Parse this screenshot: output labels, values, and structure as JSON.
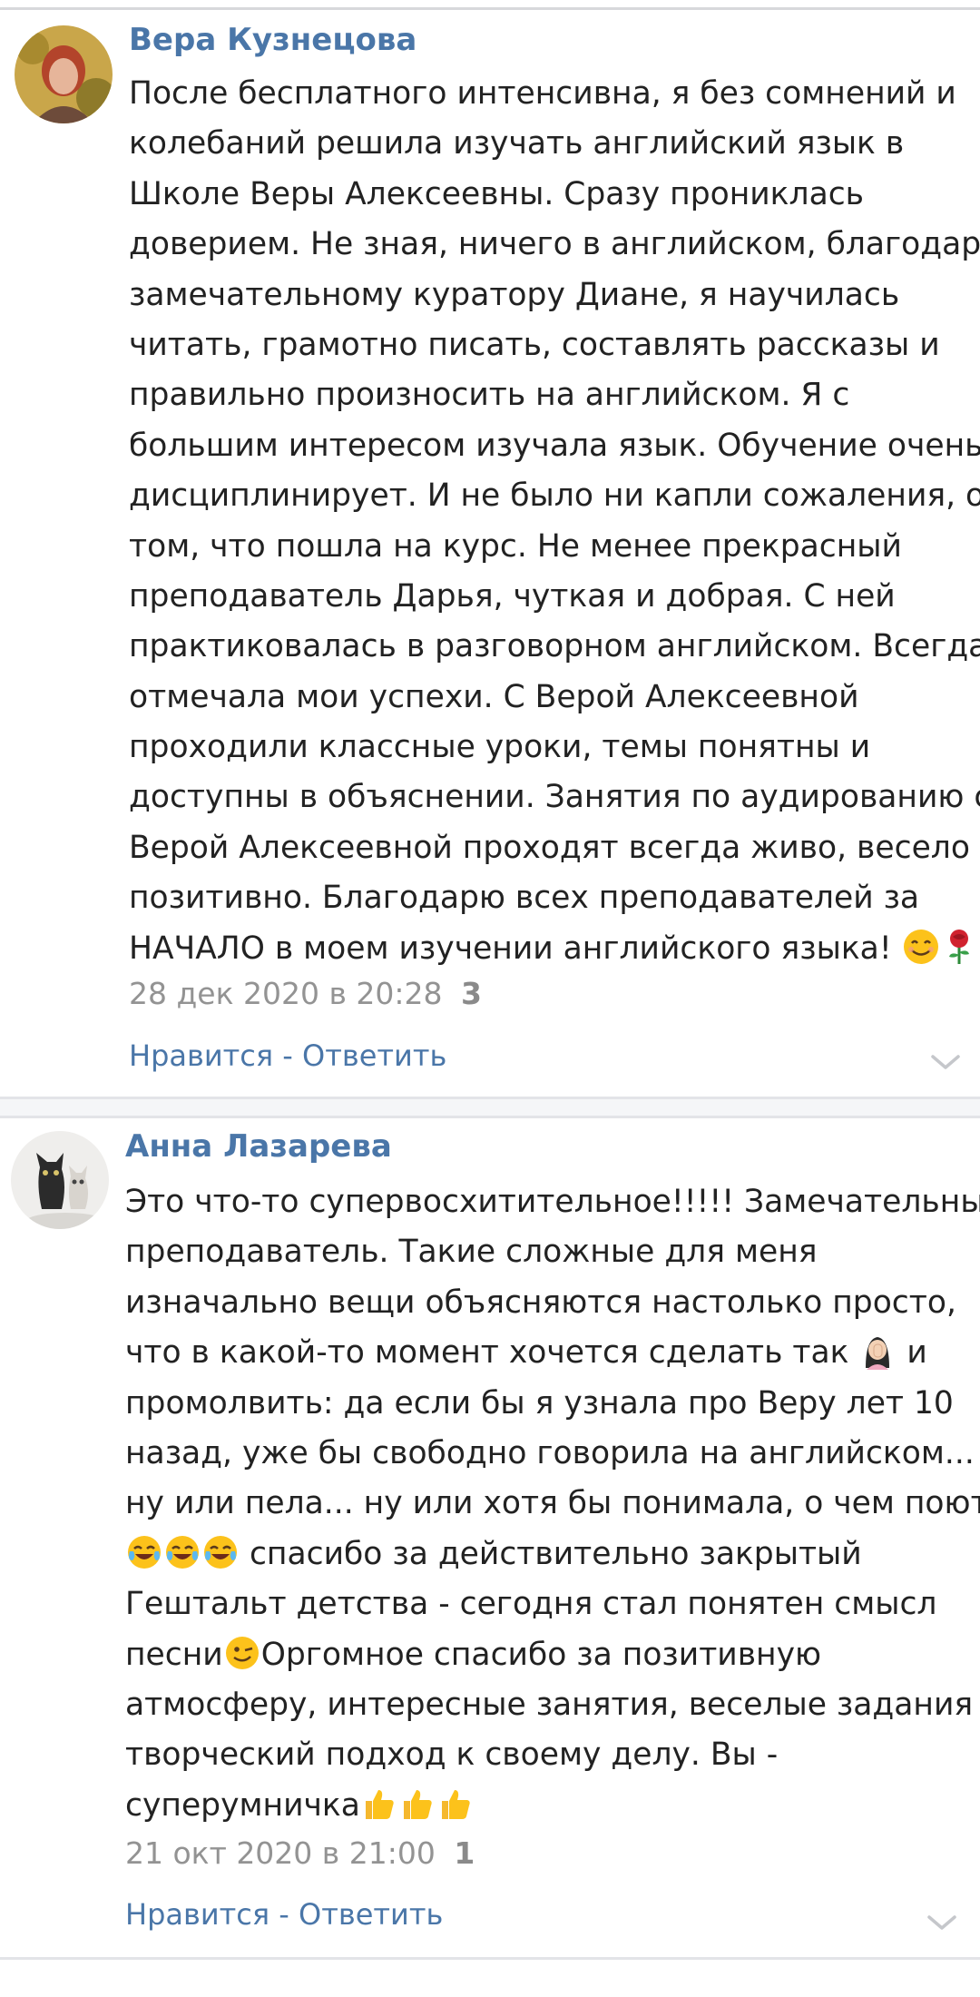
{
  "comments": [
    {
      "author": "Вера Кузнецова",
      "lines": [
        "После бесплатного интенсивна, я без сомнений и",
        "колебаний решила изучать английский язык в",
        "Школе Веры Алексеевны. Сразу прониклась",
        "доверием. Не зная, ничего в английском, благодаря",
        "замечательному куратору Диане, я научилась",
        "читать, грамотно писать, составлять рассказы и",
        "правильно произносить на английском. Я с",
        "большим интересом изучала язык. Обучение очень",
        "дисциплинирует. И не было ни капли сожаления, о",
        "том, что пошла на курс. Не менее прекрасный",
        "преподаватель Дарья, чуткая и добрая. С ней",
        "практиковалась в разговорном английском. Всегда",
        "отмечала мои успехи. С Верой Алексеевной",
        "проходили классные уроки, темы понятны и",
        "доступны в объяснении. Занятия по аудированию с",
        "Верой Алексеевной проходят всегда живо, весело и",
        "позитивно. Благодарю всех преподавателей за",
        "НАЧАЛО в моем изучении английского языка!"
      ],
      "date": "28 дек 2020 в 20:28",
      "likes": "3",
      "like_label": "Нравится",
      "separator": " - ",
      "reply_label": "Ответить",
      "avatar_icon": "user-photo-woman",
      "end_emojis": [
        "smiling-face-icon",
        "rose-icon"
      ]
    },
    {
      "author": "Анна Лазарева",
      "lines": [
        "Это что-то супервосхитительное!!!!! Замечательный",
        "преподаватель. Такие сложные для меня",
        "изначально вещи объясняются настолько просто,",
        "что в какой-то момент хочется сделать так",
        "промолвить: да если бы я узнала про Веру лет 10",
        "назад, уже бы свободно говорила на английском...",
        "ну или пела... ну или хотя бы понимала, о чем поют.",
        "спасибо за действительно закрытый",
        "Гештальт детства - сегодня стал понятен смысл",
        "песни",
        "атмосферу, интересные занятия, веселые задания и",
        "творческий подход к своему делу. Вы -",
        "суперумничка"
      ],
      "line4_tail": "и",
      "line10_tail": "Оргомное спасибо за позитивную",
      "date": "21 окт 2020 в 21:00",
      "likes": "1",
      "like_label": "Нравится",
      "separator": " - ",
      "reply_label": "Ответить",
      "avatar_icon": "user-photo-cats"
    }
  ],
  "colors": {
    "author": "#4a76a8",
    "text": "#222222",
    "meta": "#939393",
    "link": "#4a76a8"
  }
}
